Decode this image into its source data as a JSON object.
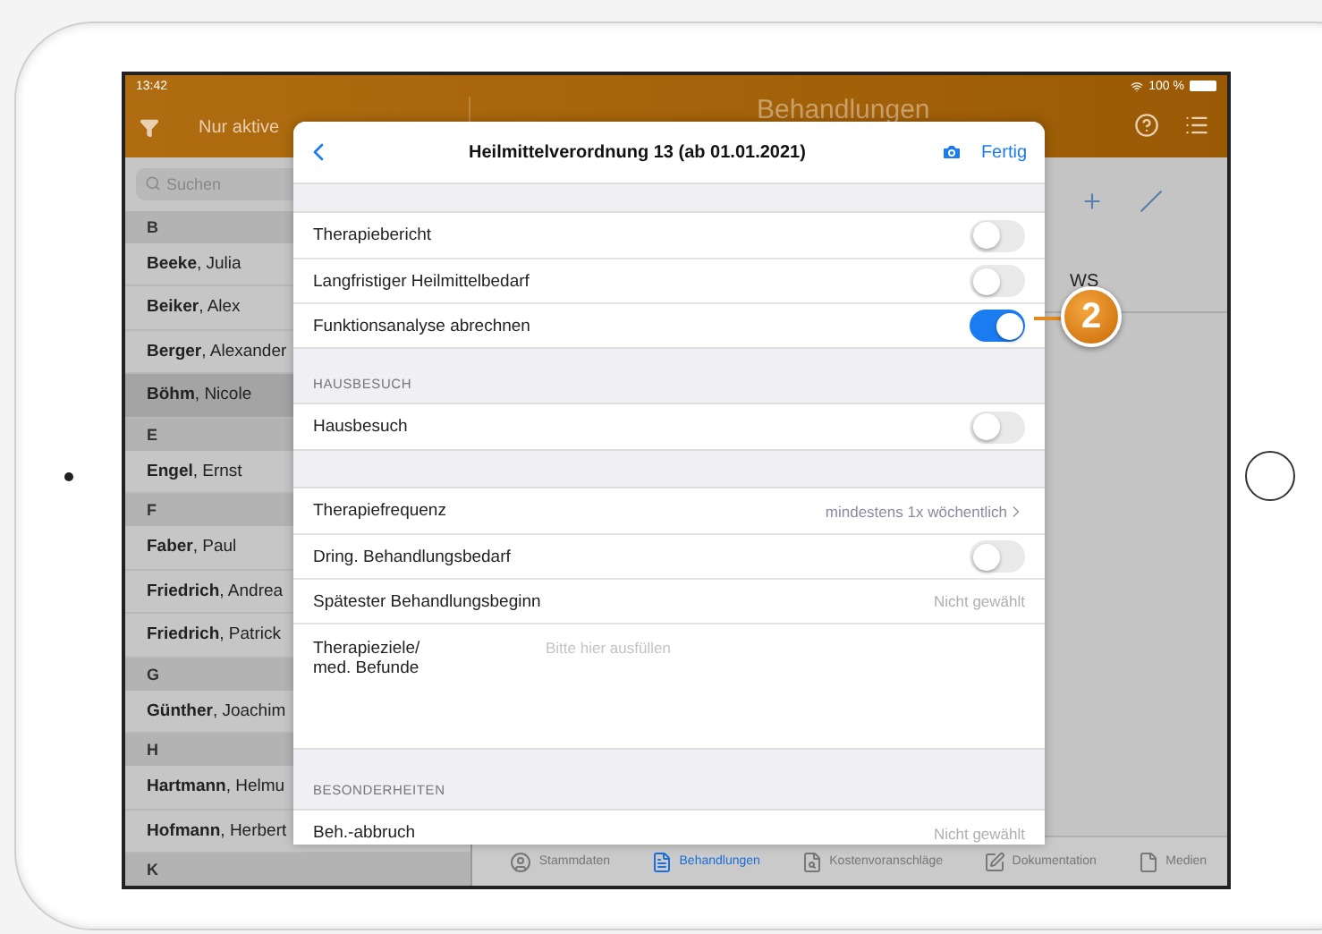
{
  "status_bar": {
    "time": "13:42",
    "battery": "100 %"
  },
  "sidebar": {
    "filter_label": "Nur aktive",
    "search_placeholder": "Suchen",
    "items": [
      {
        "kind": "header",
        "text": "B"
      },
      {
        "kind": "patient",
        "name": "**Beeke**, Julia",
        "selected": false
      },
      {
        "kind": "patient",
        "name": "**Beiker**, Alex",
        "selected": false
      },
      {
        "kind": "patient",
        "name": "**Berger**, Alexander",
        "selected": false
      },
      {
        "kind": "patient",
        "name": "**Böhm**, Nicole",
        "selected": true
      },
      {
        "kind": "header",
        "text": "E"
      },
      {
        "kind": "patient",
        "name": "**Engel**, Ernst",
        "selected": false
      },
      {
        "kind": "header",
        "text": "F"
      },
      {
        "kind": "patient",
        "name": "**Faber**, Paul",
        "selected": false
      },
      {
        "kind": "patient",
        "name": "**Friedrich**, Andrea",
        "selected": false
      },
      {
        "kind": "patient",
        "name": "**Friedrich**, Patrick",
        "selected": false
      },
      {
        "kind": "header",
        "text": "G"
      },
      {
        "kind": "patient",
        "name": "**Günther**, Joachim",
        "selected": false
      },
      {
        "kind": "header",
        "text": "H"
      },
      {
        "kind": "patient",
        "name": "**Hartmann**, Helmu",
        "selected": false
      },
      {
        "kind": "patient",
        "name": "**Hofmann**, Herbert",
        "selected": false
      },
      {
        "kind": "header",
        "text": "K"
      }
    ]
  },
  "main": {
    "title": "Behandlungen",
    "row_text": "WS"
  },
  "tab_bar": [
    {
      "label": "Stammdaten",
      "selected": false
    },
    {
      "label": "Behandlungen",
      "selected": true
    },
    {
      "label": "Kostenvoranschläge",
      "selected": false
    },
    {
      "label": "Dokumentation",
      "selected": false
    },
    {
      "label": "Medien",
      "selected": false
    }
  ],
  "modal": {
    "title": "Heilmittelverordnung 13 (ab 01.01.2021)",
    "done": "Fertig",
    "sections": [
      {
        "rows": [
          {
            "kind": "toggle",
            "label": "Therapiebericht",
            "on": false
          },
          {
            "kind": "toggle",
            "label": "Langfristiger Heilmittelbedarf",
            "on": false
          },
          {
            "kind": "toggle",
            "label": "Funktionsanalyse abrechnen",
            "on": true
          }
        ]
      },
      {
        "header": "HAUSBESUCH",
        "rows": [
          {
            "kind": "toggle",
            "label": "Hausbesuch",
            "on": false
          }
        ]
      },
      {
        "rows": [
          {
            "kind": "disclosure",
            "label": "Therapiefrequenz",
            "value": "mindestens 1x wöchentlich"
          },
          {
            "kind": "toggle",
            "label": "Dring. Behandlungsbedarf",
            "on": false
          },
          {
            "kind": "value",
            "label": "Spätester Behandlungsbeginn",
            "value": "Nicht gewählt"
          },
          {
            "kind": "textarea",
            "label": "Therapieziele/\nmed. Befunde",
            "placeholder": "Bitte hier ausfüllen"
          }
        ]
      },
      {
        "header": "BESONDERHEITEN",
        "rows": [
          {
            "kind": "value",
            "label": "Beh.-abbruch",
            "value": "Nicht gewählt"
          }
        ]
      }
    ]
  },
  "callout": {
    "number": "2"
  }
}
